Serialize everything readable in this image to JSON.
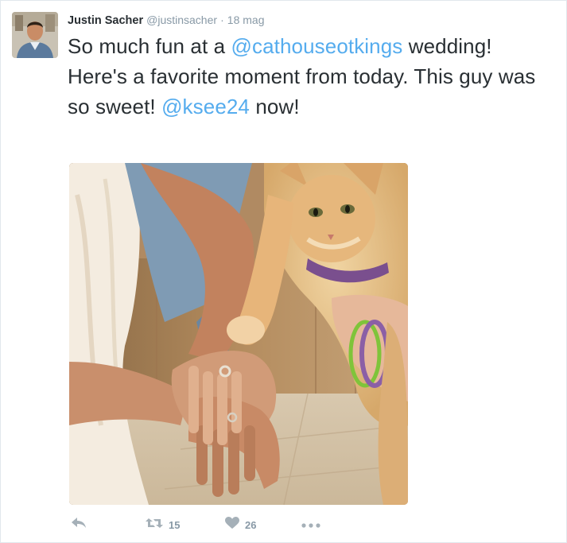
{
  "tweet": {
    "author_name": "Justin Sacher",
    "author_handle": "@justinsacher",
    "separator": "·",
    "timestamp": "18 mag",
    "text_parts": [
      {
        "type": "text",
        "value": "So much fun at a "
      },
      {
        "type": "mention",
        "value": "@cathouseotkings"
      },
      {
        "type": "text",
        "value": " wedding! Here's a favorite moment from today. This guy was so sweet! "
      },
      {
        "type": "mention",
        "value": "@ksee24"
      },
      {
        "type": "text",
        "value": " now!"
      }
    ]
  },
  "actions": {
    "reply_icon": "reply-arrow-icon",
    "retweet_icon": "retweet-icon",
    "retweet_count": "15",
    "like_icon": "heart-icon",
    "like_count": "26",
    "more_icon": "ellipsis-icon"
  },
  "colors": {
    "link": "#55acee",
    "text": "#292f33",
    "muted": "#8899a6",
    "icon": "#a5b0b8"
  }
}
